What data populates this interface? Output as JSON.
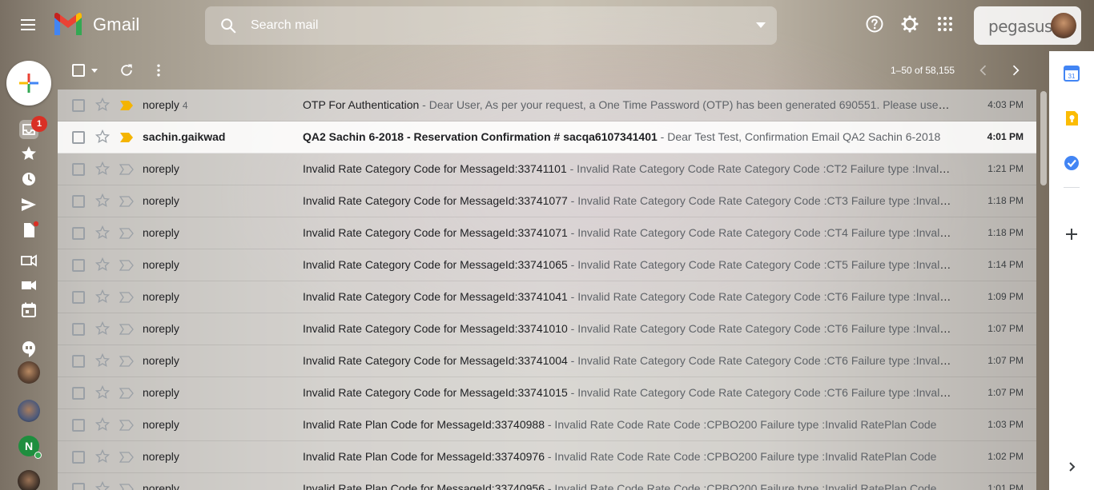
{
  "app": {
    "name": "Gmail",
    "account_brand": "pegasus"
  },
  "search": {
    "placeholder": "Search mail"
  },
  "nav": {
    "unread_badge": "1"
  },
  "chat": {
    "contact_initial": "N"
  },
  "toolbar": {
    "range": "1–50 of 58,155"
  },
  "emails": [
    {
      "sender": "noreply",
      "count": "4",
      "subject": "OTP For Authentication",
      "snippet": " - Dear User, As per your request, a One Time Password (OTP) has been generated 690551. Please use this OTP to complete the authentication",
      "time": "4:03 PM",
      "unread": false,
      "important": true
    },
    {
      "sender": "sachin.gaikwad",
      "count": "",
      "subject": "QA2 Sachin 6-2018 - Reservation Confirmation # sacqa6107341401",
      "snippet": " - Dear Test Test, Confirmation Email QA2 Sachin 6-2018",
      "time": "4:01 PM",
      "unread": true,
      "important": true
    },
    {
      "sender": "noreply",
      "count": "",
      "subject": "Invalid Rate Category Code for MessageId:33741101",
      "snippet": " - Invalid Rate Category Code Rate Category Code :CT2 Failure type :Invalid Rate Category",
      "time": "1:21 PM",
      "unread": false,
      "important": false
    },
    {
      "sender": "noreply",
      "count": "",
      "subject": "Invalid Rate Category Code for MessageId:33741077",
      "snippet": " - Invalid Rate Category Code Rate Category Code :CT3 Failure type :Invalid Rate Category",
      "time": "1:18 PM",
      "unread": false,
      "important": false
    },
    {
      "sender": "noreply",
      "count": "",
      "subject": "Invalid Rate Category Code for MessageId:33741071",
      "snippet": " - Invalid Rate Category Code Rate Category Code :CT4 Failure type :Invalid Rate Category",
      "time": "1:18 PM",
      "unread": false,
      "important": false
    },
    {
      "sender": "noreply",
      "count": "",
      "subject": "Invalid Rate Category Code for MessageId:33741065",
      "snippet": " - Invalid Rate Category Code Rate Category Code :CT5 Failure type :Invalid Rate Category",
      "time": "1:14 PM",
      "unread": false,
      "important": false
    },
    {
      "sender": "noreply",
      "count": "",
      "subject": "Invalid Rate Category Code for MessageId:33741041",
      "snippet": " - Invalid Rate Category Code Rate Category Code :CT6 Failure type :Invalid Rate Category",
      "time": "1:09 PM",
      "unread": false,
      "important": false
    },
    {
      "sender": "noreply",
      "count": "",
      "subject": "Invalid Rate Category Code for MessageId:33741010",
      "snippet": " - Invalid Rate Category Code Rate Category Code :CT6 Failure type :Invalid Rate Category",
      "time": "1:07 PM",
      "unread": false,
      "important": false
    },
    {
      "sender": "noreply",
      "count": "",
      "subject": "Invalid Rate Category Code for MessageId:33741004",
      "snippet": " - Invalid Rate Category Code Rate Category Code :CT6 Failure type :Invalid Rate Category",
      "time": "1:07 PM",
      "unread": false,
      "important": false
    },
    {
      "sender": "noreply",
      "count": "",
      "subject": "Invalid Rate Category Code for MessageId:33741015",
      "snippet": " - Invalid Rate Category Code Rate Category Code :CT6 Failure type :Invalid Rate Category",
      "time": "1:07 PM",
      "unread": false,
      "important": false
    },
    {
      "sender": "noreply",
      "count": "",
      "subject": "Invalid Rate Plan Code for MessageId:33740988",
      "snippet": " - Invalid Rate Code Rate Code :CPBO200 Failure type :Invalid RatePlan Code",
      "time": "1:03 PM",
      "unread": false,
      "important": false
    },
    {
      "sender": "noreply",
      "count": "",
      "subject": "Invalid Rate Plan Code for MessageId:33740976",
      "snippet": " - Invalid Rate Code Rate Code :CPBO200 Failure type :Invalid RatePlan Code",
      "time": "1:02 PM",
      "unread": false,
      "important": false
    },
    {
      "sender": "noreply",
      "count": "",
      "subject": "Invalid Rate Plan Code for MessageId:33740956",
      "snippet": " - Invalid Rate Code Rate Code :CPBO200 Failure type :Invalid RatePlan Code",
      "time": "1:01 PM",
      "unread": false,
      "important": false
    }
  ],
  "colors": {
    "important_marker": "#f4b400",
    "badge": "#d93025",
    "chat_online": "#34a853"
  }
}
